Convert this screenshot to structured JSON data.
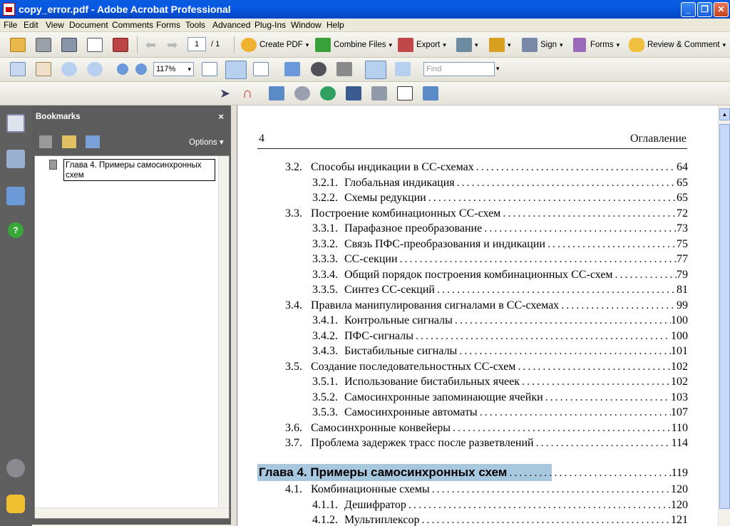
{
  "window": {
    "title": "copy_error.pdf - Adobe Acrobat Professional"
  },
  "menu": [
    "File",
    "Edit",
    "View",
    "Document",
    "Comments",
    "Forms",
    "Tools",
    "Advanced",
    "Plug-Ins",
    "Window",
    "Help"
  ],
  "toolbar1": {
    "page_current": "1",
    "page_total": "/ 1",
    "create_pdf": "Create PDF",
    "combine_files": "Combine Files",
    "export": "Export",
    "sign": "Sign",
    "forms": "Forms",
    "review_comment": "Review & Comment"
  },
  "toolbar2": {
    "zoom": "117%",
    "find_placeholder": "Find"
  },
  "bookmarks": {
    "title": "Bookmarks",
    "options": "Options",
    "items": [
      {
        "label": "Глава 4. Примеры самосинхронных схем"
      }
    ]
  },
  "document": {
    "page_number": "4",
    "header": "Оглавление",
    "toc": [
      {
        "num": "3.2.",
        "title": "Способы индикации в СС-схемах",
        "page": "64",
        "level": 1
      },
      {
        "num": "3.2.1.",
        "title": "Глобальная индикация",
        "page": "65",
        "level": 2
      },
      {
        "num": "3.2.2.",
        "title": "Схемы редукции",
        "page": "65",
        "level": 2
      },
      {
        "num": "3.3.",
        "title": "Построение комбинационных СС-схем",
        "page": "72",
        "level": 1
      },
      {
        "num": "3.3.1.",
        "title": "Парафазное преобразование",
        "page": "73",
        "level": 2
      },
      {
        "num": "3.3.2.",
        "title": "Связь ПФС-преобразования и индикации",
        "page": "75",
        "level": 2
      },
      {
        "num": "3.3.3.",
        "title": "СС-секции",
        "page": "77",
        "level": 2
      },
      {
        "num": "3.3.4.",
        "title": "Общий порядок построения комбинационных СС-схем",
        "page": "79",
        "level": 2
      },
      {
        "num": "3.3.5.",
        "title": "Синтез СС-секций",
        "page": "81",
        "level": 2
      },
      {
        "num": "3.4.",
        "title": "Правила манипулирования сигналами в СС-схемах",
        "page": "99",
        "level": 1
      },
      {
        "num": "3.4.1.",
        "title": "Контрольные сигналы",
        "page": "100",
        "level": 2
      },
      {
        "num": "3.4.2.",
        "title": "ПФС-сигналы",
        "page": "100",
        "level": 2
      },
      {
        "num": "3.4.3.",
        "title": "Бистабильные сигналы",
        "page": "101",
        "level": 2
      },
      {
        "num": "3.5.",
        "title": "Создание последовательностных СС-схем",
        "page": "102",
        "level": 1
      },
      {
        "num": "3.5.1.",
        "title": "Использование бистабильных ячеек",
        "page": "102",
        "level": 2
      },
      {
        "num": "3.5.2.",
        "title": "Самосинхронные запоминающие ячейки",
        "page": "103",
        "level": 2
      },
      {
        "num": "3.5.3.",
        "title": "Самосинхронные автоматы",
        "page": "107",
        "level": 2
      },
      {
        "num": "3.6.",
        "title": "Самосинхронные конвейеры",
        "page": "110",
        "level": 1
      },
      {
        "num": "3.7.",
        "title": "Проблема задержек трасс после разветвлений",
        "page": "114",
        "level": 1
      }
    ],
    "chapter": {
      "title": "Глава 4. Примеры самосинхронных схем",
      "page": "119"
    },
    "toc_after": [
      {
        "num": "4.1.",
        "title": "Комбинационные схемы",
        "page": "120",
        "level": 1
      },
      {
        "num": "4.1.1.",
        "title": "Дешифратор",
        "page": "120",
        "level": 2
      },
      {
        "num": "4.1.2.",
        "title": "Мультиплексор",
        "page": "121",
        "level": 2
      }
    ]
  },
  "colors": {
    "title_bar": "#0758e2",
    "selection": "#a8c8e0",
    "panel": "#5c5c5c"
  }
}
